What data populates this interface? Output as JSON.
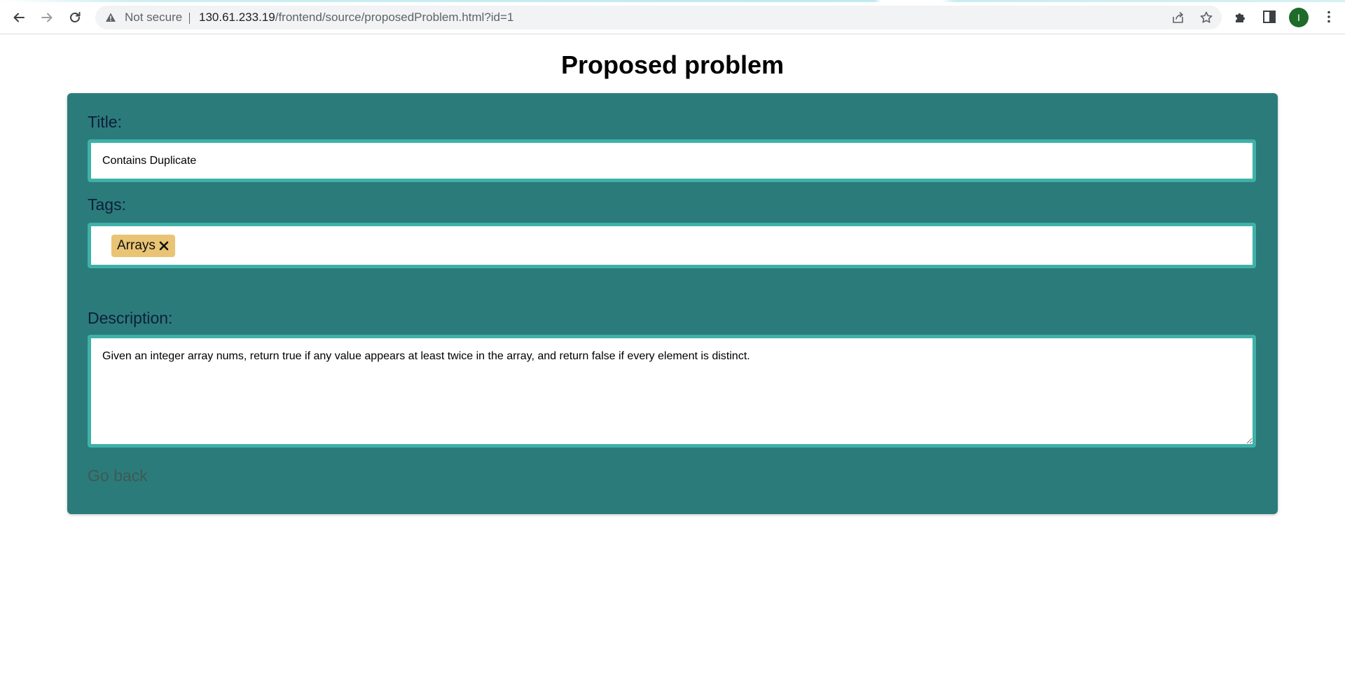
{
  "browser": {
    "security_label": "Not secure",
    "url_host": "130.61.233.19",
    "url_path": "/frontend/source/proposedProblem.html?id=1",
    "avatar_initial": "I",
    "avatar_color": "#1e6b2a"
  },
  "page": {
    "title": "Proposed problem"
  },
  "form": {
    "title_label": "Title:",
    "title_value": "Contains Duplicate",
    "tags_label": "Tags:",
    "tags": [
      {
        "label": "Arrays"
      }
    ],
    "description_label": "Description:",
    "description_value": "Given an integer array nums, return true if any value appears at least twice in the array, and return false if every element is distinct.",
    "go_back_label": "Go back"
  },
  "colors": {
    "card_background": "#2b7b7a",
    "input_border": "#3eb1a9",
    "tag_background": "#e9c474",
    "label_text": "#0d1f3a",
    "go_back_text": "#3f5a55"
  }
}
